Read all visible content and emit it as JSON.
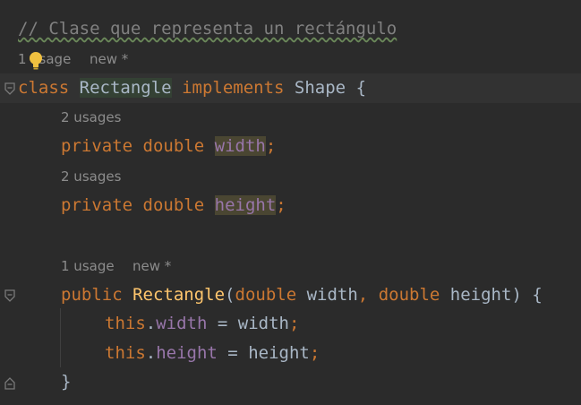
{
  "editor": {
    "comment": "// Clase que representa un rectángulo",
    "hints": {
      "class_usage_prefix": "1",
      "class_usage_suffix": "sage",
      "class_new": "new *",
      "width_usages": "2 usages",
      "height_usages": "2 usages",
      "ctor_usage": "1 usage",
      "ctor_new": "new *"
    },
    "class_decl": {
      "kw_class": "class",
      "name": "Rectangle",
      "kw_implements": "implements",
      "iface": "Shape",
      "brace": "{"
    },
    "field_width": {
      "kw_private": "private",
      "type": "double",
      "name": "width",
      "semi": ";"
    },
    "field_height": {
      "kw_private": "private",
      "type": "double",
      "name": "height",
      "semi": ";"
    },
    "ctor": {
      "kw_public": "public",
      "name": "Rectangle",
      "open": "(",
      "type1": "double",
      "param1": "width",
      "comma": ",",
      "type2": "double",
      "param2": "height",
      "close": ") {"
    },
    "assign_width": {
      "this": "this",
      "dot": ".",
      "field": "width",
      "eq": " = ",
      "value": "width",
      "semi": ";"
    },
    "assign_height": {
      "this": "this",
      "dot": ".",
      "field": "height",
      "eq": " = ",
      "value": "height",
      "semi": ";"
    },
    "close_brace": "}"
  },
  "icons": {
    "bulb": "lightbulb-icon",
    "fold": "fold-marker-icon"
  },
  "colors": {
    "background": "#2b2b2b",
    "keyword": "#cc7832",
    "field": "#9876aa",
    "method": "#ffc66d",
    "comment": "#808080",
    "hint": "#8c8c8c"
  }
}
